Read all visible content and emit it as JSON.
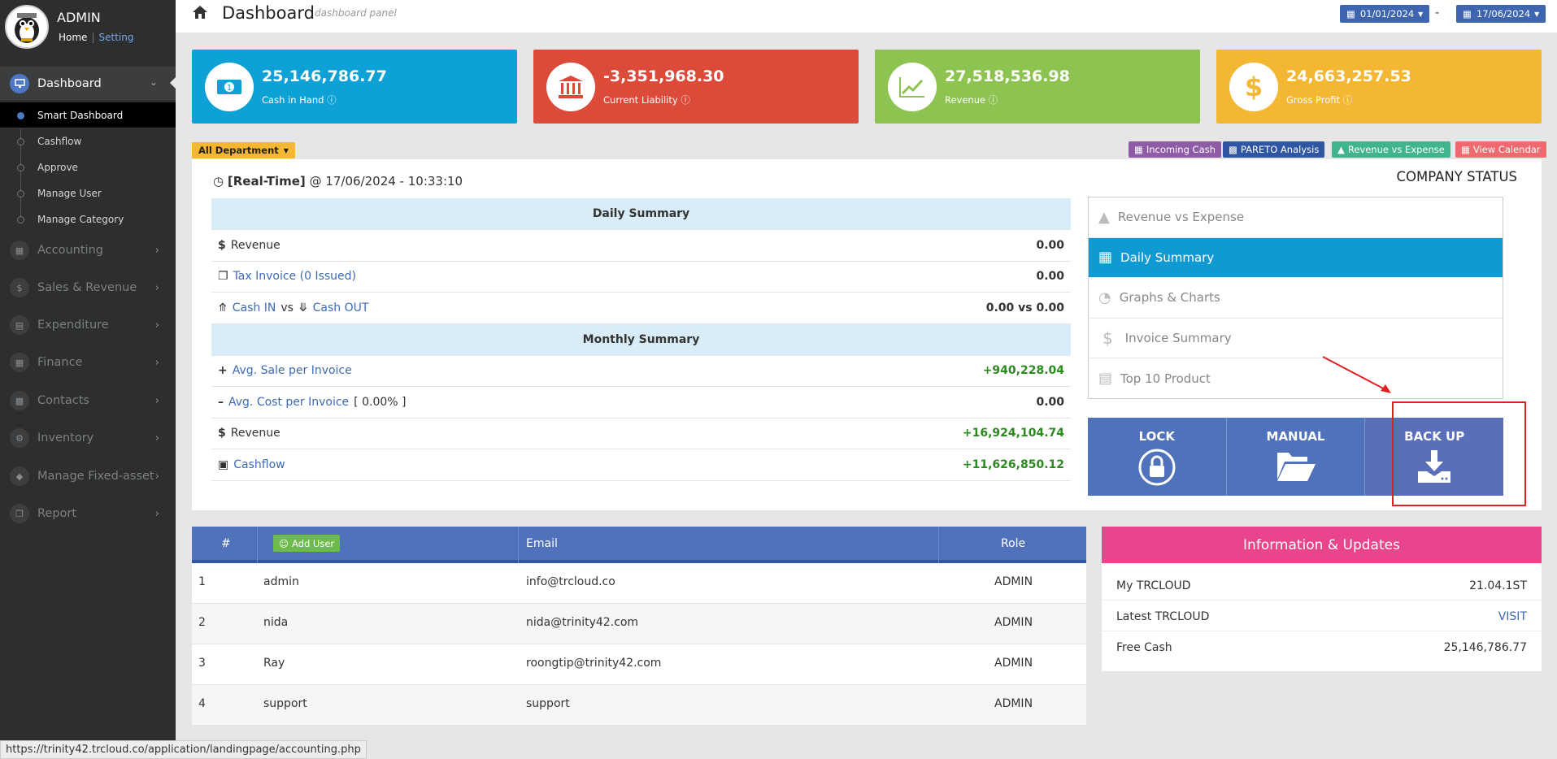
{
  "user": {
    "name": "ADMIN",
    "home": "Home",
    "setting": "Setting",
    "separator": "|"
  },
  "sidebar": {
    "main": {
      "label": "Dashboard"
    },
    "subitems": [
      {
        "label": "Smart Dashboard",
        "active": true
      },
      {
        "label": "Cashflow"
      },
      {
        "label": "Approve"
      },
      {
        "label": "Manage User"
      },
      {
        "label": "Manage Category"
      }
    ],
    "menus": [
      {
        "label": "Accounting",
        "icon": "book-icon"
      },
      {
        "label": "Sales & Revenue",
        "icon": "dollar-icon"
      },
      {
        "label": "Expenditure",
        "icon": "cart-icon"
      },
      {
        "label": "Finance",
        "icon": "calendar-icon"
      },
      {
        "label": "Contacts",
        "icon": "contact-icon"
      },
      {
        "label": "Inventory",
        "icon": "gears-icon"
      },
      {
        "label": "Manage Fixed-asset",
        "icon": "diamond-icon"
      },
      {
        "label": "Report",
        "icon": "copy-icon"
      }
    ]
  },
  "header": {
    "title": "Dashboard",
    "subtitle": "dashboard panel",
    "date_from": "01/01/2024",
    "date_to": "17/06/2024",
    "dash": "-"
  },
  "stats": [
    {
      "value": "25,146,786.77",
      "label": "Cash in Hand",
      "color": "#0ea1d6",
      "icon": "money-icon"
    },
    {
      "value": "-3,351,968.30",
      "label": "Current Liability",
      "color": "#dc4a3a",
      "icon": "bank-icon"
    },
    {
      "value": "27,518,536.98",
      "label": "Revenue",
      "color": "#8dc451",
      "icon": "chart-line-icon"
    },
    {
      "value": "24,663,257.53",
      "label": "Gross Profit",
      "color": "#f4b733",
      "icon": "dollar-icon"
    }
  ],
  "filter": {
    "department": "All Department"
  },
  "quick": [
    {
      "label": "Incoming Cash",
      "color": "#8e5ba6"
    },
    {
      "label": "PARETO Analysis",
      "color": "#2f56a3"
    },
    {
      "label": "Revenue vs Expense",
      "color": "#3fb48f"
    },
    {
      "label": "View Calendar",
      "color": "#ef6a6f"
    }
  ],
  "realtime": {
    "prefix": "[Real-Time]",
    "at": "@ 17/06/2024 - 10:33:10"
  },
  "company_status": "COMPANY STATUS",
  "daily": {
    "title": "Daily Summary",
    "revenue_label": "Revenue",
    "revenue_value": "0.00",
    "tax_label": "Tax Invoice (0 Issued)",
    "tax_value": "0.00",
    "cash_in": "Cash IN",
    "vs": "vs",
    "cash_out": "Cash OUT",
    "cash_value": "0.00 vs 0.00"
  },
  "monthly": {
    "title": "Monthly Summary",
    "avg_sale_label": "Avg. Sale per Invoice",
    "avg_sale_value": "+940,228.04",
    "avg_cost_label": "Avg. Cost per Invoice",
    "avg_cost_pct": "[ 0.00% ]",
    "avg_cost_value": "0.00",
    "revenue_label": "Revenue",
    "revenue_value": "+16,924,104.74",
    "cashflow_label": "Cashflow",
    "cashflow_value": "+11,626,850.12"
  },
  "status_menu": [
    {
      "label": "Revenue vs Expense",
      "icon": "area-chart-icon"
    },
    {
      "label": "Daily Summary",
      "icon": "calendar-plus-icon",
      "active": true
    },
    {
      "label": "Graphs & Charts",
      "icon": "pie-chart-icon"
    },
    {
      "label": "Invoice Summary",
      "icon": "dollar-icon"
    },
    {
      "label": "Top 10 Product",
      "icon": "newspaper-icon"
    }
  ],
  "actions": [
    {
      "label": "LOCK",
      "icon": "lock-icon"
    },
    {
      "label": "MANUAL",
      "icon": "folder-open-icon"
    },
    {
      "label": "BACK UP",
      "icon": "download-icon"
    }
  ],
  "users_table": {
    "headers": {
      "num": "#",
      "add": "Add User",
      "email": "Email",
      "role": "Role"
    },
    "rows": [
      {
        "num": "1",
        "name": "admin",
        "email": "info@trcloud.co",
        "role": "ADMIN"
      },
      {
        "num": "2",
        "name": "nida",
        "email": "nida@trinity42.com",
        "role": "ADMIN"
      },
      {
        "num": "3",
        "name": "Ray",
        "email": "roongtip@trinity42.com",
        "role": "ADMIN"
      },
      {
        "num": "4",
        "name": "support",
        "email": "support",
        "role": "ADMIN"
      }
    ]
  },
  "info": {
    "title": "Information & Updates",
    "rows": [
      {
        "label": "My TRCLOUD",
        "value": "21.04.1ST"
      },
      {
        "label": "Latest TRCLOUD",
        "value": "VISIT"
      },
      {
        "label": "Free Cash",
        "value": "25,146,786.77"
      }
    ]
  },
  "status_url": "https://trinity42.trcloud.co/application/landingpage/accounting.php"
}
